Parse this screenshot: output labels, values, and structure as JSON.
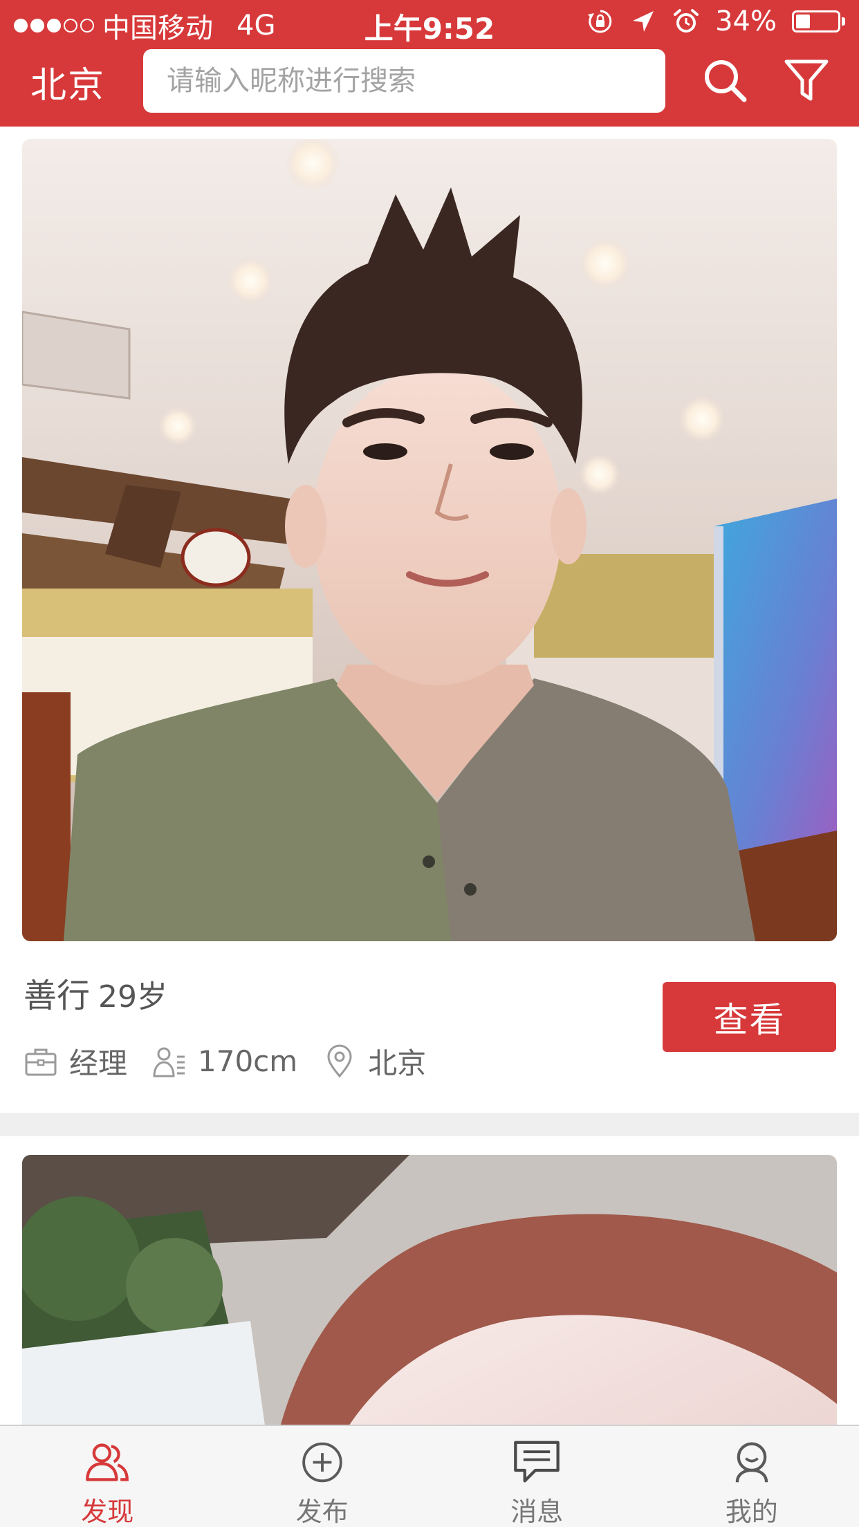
{
  "status_bar": {
    "signal_filled": 3,
    "signal_total": 5,
    "carrier": "中国移动",
    "network": "4G",
    "time": "上午9:52",
    "icons": [
      "rotation-lock-icon",
      "location-arrow-icon",
      "alarm-icon"
    ],
    "battery_text": "34%",
    "battery_level": 0.34
  },
  "header": {
    "city": "北京",
    "search_placeholder": "请输入昵称进行搜索",
    "search_icon": "search-icon",
    "filter_icon": "filter-icon"
  },
  "feed": {
    "cards": [
      {
        "photo": "profile-photo",
        "name": "善行",
        "age": "29岁",
        "view_label": "查看",
        "occupation": "经理",
        "height": "170cm",
        "location": "北京"
      },
      {
        "photo": "profile-photo"
      }
    ]
  },
  "tab_bar": {
    "active_index": 0,
    "tabs": [
      {
        "label": "发现",
        "icon": "discover-users-icon"
      },
      {
        "label": "发布",
        "icon": "plus-circle-icon"
      },
      {
        "label": "消息",
        "icon": "message-bubble-icon"
      },
      {
        "label": "我的",
        "icon": "profile-icon"
      }
    ]
  },
  "colors": {
    "brand": "#d7393a",
    "background": "#efefef",
    "tab_inactive": "#777777"
  }
}
